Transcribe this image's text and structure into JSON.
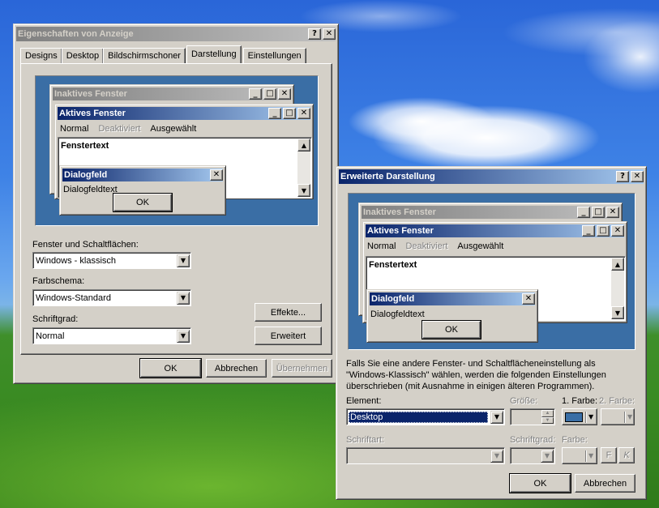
{
  "display_properties": {
    "title": "Eigenschaften von Anzeige",
    "help_button": "?",
    "close_button": "✕",
    "tabs": [
      {
        "label": "Designs"
      },
      {
        "label": "Desktop"
      },
      {
        "label": "Bildschirmschoner"
      },
      {
        "label": "Darstellung",
        "selected": true
      },
      {
        "label": "Einstellungen"
      }
    ],
    "preview": {
      "inactive_title": "Inaktives Fenster",
      "active_title": "Aktives Fenster",
      "menu_normal": "Normal",
      "menu_disabled": "Deaktiviert",
      "menu_selected": "Ausgewählt",
      "window_text": "Fenstertext",
      "dialog_title": "Dialogfeld",
      "dialog_text": "Dialogfeldtext",
      "dialog_ok": "OK"
    },
    "windows_buttons_label": "Fenster und Schaltflächen:",
    "windows_buttons_value": "Windows - klassisch",
    "color_scheme_label": "Farbschema:",
    "color_scheme_value": "Windows-Standard",
    "font_size_label": "Schriftgrad:",
    "font_size_value": "Normal",
    "effects_button": "Effekte...",
    "advanced_button": "Erweitert",
    "ok_button": "OK",
    "cancel_button": "Abbrechen",
    "apply_button": "Übernehmen"
  },
  "advanced_appearance": {
    "title": "Erweiterte Darstellung",
    "help_button": "?",
    "close_button": "✕",
    "preview": {
      "inactive_title": "Inaktives Fenster",
      "active_title": "Aktives Fenster",
      "menu_normal": "Normal",
      "menu_disabled": "Deaktiviert",
      "menu_selected": "Ausgewählt",
      "window_text": "Fenstertext",
      "dialog_title": "Dialogfeld",
      "dialog_text": "Dialogfeldtext",
      "dialog_ok": "OK"
    },
    "info_text": "Falls Sie eine andere Fenster- und Schaltflächeneinstellung als \"Windows-Klassisch\" wählen, werden die folgenden Einstellungen überschrieben (mit Ausnahme in einigen älteren Programmen).",
    "element_label": "Element:",
    "element_value": "Desktop",
    "size_label": "Größe:",
    "color1_label": "1. Farbe:",
    "color2_label": "2. Farbe:",
    "color1_value": "#3a6ea5",
    "font_label": "Schriftart:",
    "font_size_label": "Schriftgrad:",
    "font_color_label": "Farbe:",
    "bold_button": "F",
    "italic_button": "K",
    "ok_button": "OK",
    "cancel_button": "Abbrechen"
  }
}
